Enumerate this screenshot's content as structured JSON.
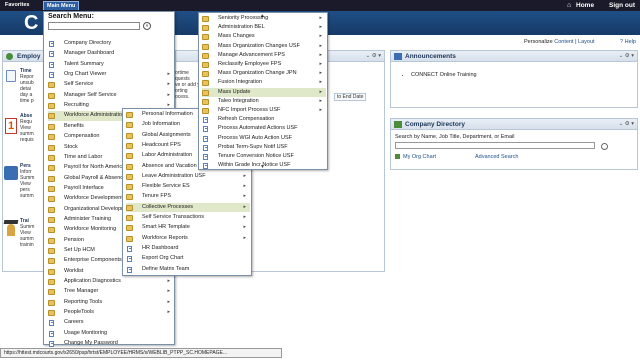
{
  "topbar": {
    "favorites": "Favorites",
    "main_menu": "Main Menu"
  },
  "header": {
    "home": "Home",
    "sign_out": "Sign out",
    "logo_letter": "C"
  },
  "personalize": {
    "prefix": "Personalize",
    "content": "Content",
    "separator": "|",
    "layout": "Layout",
    "help": "Help"
  },
  "left_pagelet": {
    "title": "Employ"
  },
  "left_items": [
    {
      "text": "Time",
      "sub": "Repor\nunsub\ndetai\nday a\ntime p"
    },
    {
      "text": "Abse",
      "sub": "Requ\nView \nsumm\nrequis"
    },
    {
      "text": "Pers",
      "sub": "Inforr\nSumm\nView \npers\nsumm"
    },
    {
      "text": "Trai",
      "sub": "Summ\nView \nsumm\ntrainin"
    }
  ],
  "mid_pagelet": {
    "frag1": "ortime",
    "frag2": "quests",
    "frag3": "ve or add y",
    "frag4": "orting",
    "frag5": "ocess.",
    "frag6": "to End Date"
  },
  "announcements": {
    "title": "Announcements",
    "items": [
      "CONNECT Online Training"
    ]
  },
  "company_directory": {
    "title": "Company Directory",
    "prompt": "Search by Name, Job Title, Department, or Email",
    "my_org_chart": "My Org Chart",
    "advanced_search": "Advanced Search"
  },
  "main_menu": {
    "search_label": "Search Menu:",
    "items": [
      {
        "label": "Company Directory",
        "type": "page",
        "arrow": false
      },
      {
        "label": "Manager Dashboard",
        "type": "page",
        "arrow": false
      },
      {
        "label": "Talent Summary",
        "type": "page",
        "arrow": false
      },
      {
        "label": "Org Chart Viewer",
        "type": "page",
        "arrow": true
      },
      {
        "label": "Self Service",
        "type": "folder",
        "arrow": true
      },
      {
        "label": "Manager Self Service",
        "type": "folder",
        "arrow": true
      },
      {
        "label": "Recruiting",
        "type": "folder",
        "arrow": true
      },
      {
        "label": "Workforce Administration",
        "type": "folder",
        "arrow": true,
        "selected": true
      },
      {
        "label": "Benefits",
        "type": "folder",
        "arrow": false
      },
      {
        "label": "Compensation",
        "type": "folder",
        "arrow": false
      },
      {
        "label": "Stock",
        "type": "folder",
        "arrow": false
      },
      {
        "label": "Time and Labor",
        "type": "folder",
        "arrow": false
      },
      {
        "label": "Payroll for North America",
        "type": "folder",
        "arrow": false
      },
      {
        "label": "Global Payroll & Absence",
        "type": "folder",
        "arrow": false
      },
      {
        "label": "Payroll Interface",
        "type": "folder",
        "arrow": false
      },
      {
        "label": "Workforce Development",
        "type": "folder",
        "arrow": false
      },
      {
        "label": "Organizational Development",
        "type": "folder",
        "arrow": false
      },
      {
        "label": "Administer Training",
        "type": "folder",
        "arrow": false
      },
      {
        "label": "Workforce Monitoring",
        "type": "folder",
        "arrow": false
      },
      {
        "label": "Pension",
        "type": "folder",
        "arrow": false
      },
      {
        "label": "Set Up HCM",
        "type": "folder",
        "arrow": false
      },
      {
        "label": "Enterprise Components",
        "type": "folder",
        "arrow": false
      },
      {
        "label": "Worklist",
        "type": "folder",
        "arrow": false
      },
      {
        "label": "Application Diagnostics",
        "type": "folder",
        "arrow": true
      },
      {
        "label": "Tree Manager",
        "type": "folder",
        "arrow": true
      },
      {
        "label": "Reporting Tools",
        "type": "folder",
        "arrow": true
      },
      {
        "label": "PeopleTools",
        "type": "folder",
        "arrow": true
      },
      {
        "label": "Careers",
        "type": "page",
        "arrow": false
      },
      {
        "label": "Usage Monitoring",
        "type": "page",
        "arrow": false
      },
      {
        "label": "Change My Password",
        "type": "page",
        "arrow": false
      }
    ]
  },
  "submenu_workforce": {
    "items": [
      {
        "label": "Personal Information",
        "type": "folder",
        "arrow": true
      },
      {
        "label": "Job Information",
        "type": "folder",
        "arrow": true
      },
      {
        "label": "Global Assignments",
        "type": "folder",
        "arrow": true
      },
      {
        "label": "Headcount FPS",
        "type": "folder",
        "arrow": true
      },
      {
        "label": "Labor Administration",
        "type": "folder",
        "arrow": true
      },
      {
        "label": "Absence and Vacation",
        "type": "folder",
        "arrow": true
      },
      {
        "label": "Leave Administration USF",
        "type": "folder",
        "arrow": true
      },
      {
        "label": "Flexible Service ES",
        "type": "folder",
        "arrow": true
      },
      {
        "label": "Tenure FPS",
        "type": "folder",
        "arrow": true
      },
      {
        "label": "Collective Processes",
        "type": "folder",
        "arrow": true,
        "selected": true
      },
      {
        "label": "Self Service Transactions",
        "type": "folder",
        "arrow": true
      },
      {
        "label": "Smart HR Template",
        "type": "folder",
        "arrow": true
      },
      {
        "label": "Workforce Reports",
        "type": "folder",
        "arrow": true
      },
      {
        "label": "HR Dashboard",
        "type": "page",
        "arrow": false
      },
      {
        "label": "Export Org Chart",
        "type": "page",
        "arrow": false
      },
      {
        "label": "Define Matrix Team",
        "type": "page",
        "arrow": false
      }
    ]
  },
  "submenu_collective": {
    "items": [
      {
        "label": "Seniority Processing",
        "type": "folder",
        "arrow": true
      },
      {
        "label": "Administration BEL",
        "type": "folder",
        "arrow": true
      },
      {
        "label": "Mass Changes",
        "type": "folder",
        "arrow": true
      },
      {
        "label": "Mass Organization Changes USF",
        "type": "folder",
        "arrow": true
      },
      {
        "label": "Manage Advancement FPS",
        "type": "folder",
        "arrow": true
      },
      {
        "label": "Reclassify Employee FPS",
        "type": "folder",
        "arrow": true
      },
      {
        "label": "Mass Organization Change JPN",
        "type": "folder",
        "arrow": true
      },
      {
        "label": "Fusion Integration",
        "type": "folder",
        "arrow": true
      },
      {
        "label": "Mass Update",
        "type": "folder",
        "arrow": true,
        "selected": true
      },
      {
        "label": "Taleo Integration",
        "type": "folder",
        "arrow": true
      },
      {
        "label": "NFC Import Process USF",
        "type": "folder",
        "arrow": true
      },
      {
        "label": "Refresh Compensation",
        "type": "page",
        "arrow": false
      },
      {
        "label": "Process Automated Actions USF",
        "type": "page",
        "arrow": false
      },
      {
        "label": "Process WGI Auto Action USF",
        "type": "page",
        "arrow": false
      },
      {
        "label": "Probat Term-Supv Notif USF",
        "type": "page",
        "arrow": false
      },
      {
        "label": "Tenure Conversion Notice USF",
        "type": "page",
        "arrow": false
      },
      {
        "label": "Within Grade Incr Notice USF",
        "type": "page",
        "arrow": false
      }
    ]
  },
  "status_bar": "https://httest.mdcourts.gov/s2650/psp/hrtst/EMPLOYEE/HRMS/s/WEBLIB_PTPP_SC.HOMEPAGE..."
}
